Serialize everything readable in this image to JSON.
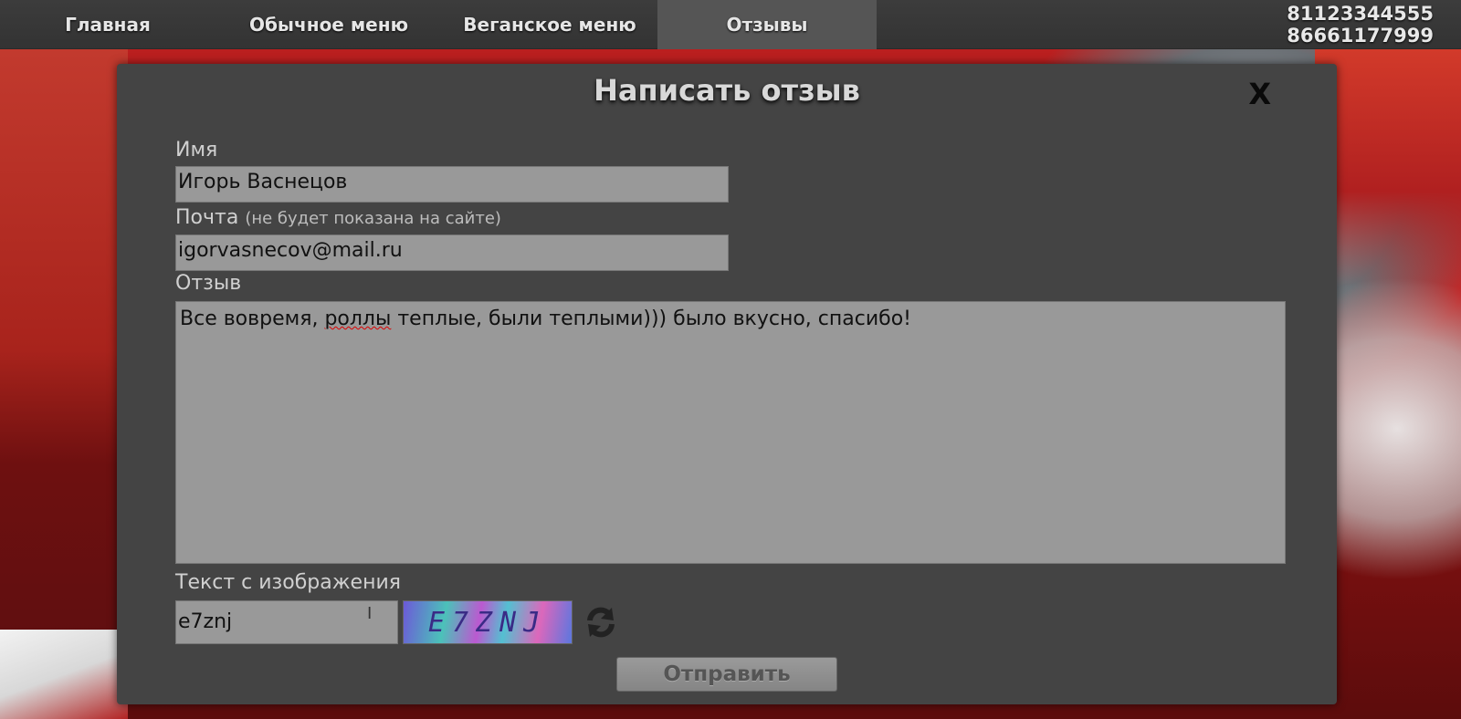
{
  "nav": {
    "items": [
      {
        "label": "Главная"
      },
      {
        "label": "Обычное меню"
      },
      {
        "label": "Веганское меню"
      },
      {
        "label": "Отзывы"
      }
    ],
    "active_index": 3,
    "phones": [
      "81123344555",
      "86661177999"
    ]
  },
  "modal": {
    "title": "Написать отзыв",
    "close_label": "X",
    "name": {
      "label": "Имя",
      "value": "Игорь Васнецов"
    },
    "email": {
      "label": "Почта",
      "hint": "(не будет показана на сайте)",
      "value": "igorvasnecov@mail.ru"
    },
    "review": {
      "label": "Отзыв",
      "text_before": "Все вовремя, ",
      "misspelled": "роллы",
      "text_after": " теплые, были теплыми))) было вкусно, спасибо!"
    },
    "captcha": {
      "label": "Текст с изображения",
      "value": "e7znj",
      "image_text": "E7ZNJ"
    },
    "submit_label": "Отправить"
  },
  "icons": {
    "refresh": "refresh-icon",
    "close": "close-icon"
  }
}
